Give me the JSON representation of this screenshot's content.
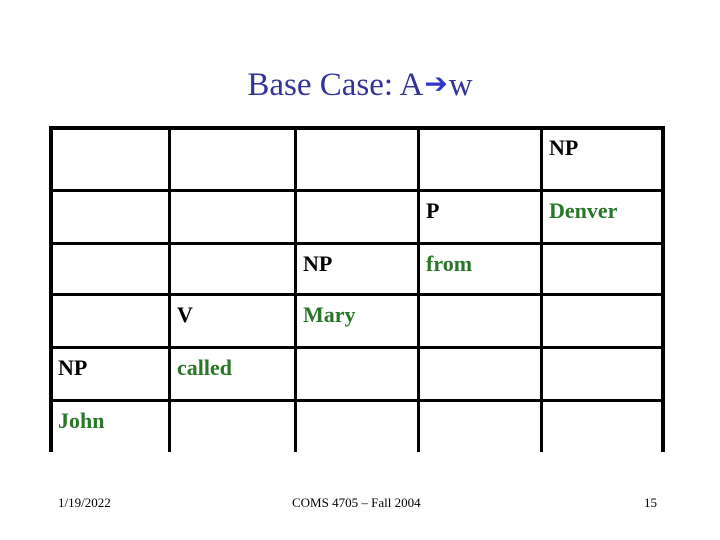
{
  "slide": {
    "title": {
      "prefix": "Base Case: A",
      "arrow": "➔",
      "suffix": "w"
    },
    "chart_table": {
      "rows": 6,
      "cols": 5,
      "cells": [
        {
          "row": 0,
          "col": 4,
          "text": "NP",
          "kind": "label"
        },
        {
          "row": 1,
          "col": 3,
          "text": "P",
          "kind": "label"
        },
        {
          "row": 1,
          "col": 4,
          "text": "Denver",
          "kind": "word"
        },
        {
          "row": 2,
          "col": 2,
          "text": "NP",
          "kind": "label"
        },
        {
          "row": 2,
          "col": 3,
          "text": "from",
          "kind": "word"
        },
        {
          "row": 3,
          "col": 1,
          "text": "V",
          "kind": "label"
        },
        {
          "row": 3,
          "col": 2,
          "text": "Mary",
          "kind": "word"
        },
        {
          "row": 4,
          "col": 0,
          "text": "NP",
          "kind": "label"
        },
        {
          "row": 4,
          "col": 1,
          "text": "called",
          "kind": "word"
        },
        {
          "row": 5,
          "col": 0,
          "text": "John",
          "kind": "word"
        }
      ]
    },
    "colors": {
      "title": "#333399",
      "arrow": "#3333cc",
      "word": "#287828",
      "label": "#000000"
    },
    "footer": {
      "date": "1/19/2022",
      "course": "COMS 4705 – Fall 2004",
      "page_number": "15"
    }
  }
}
